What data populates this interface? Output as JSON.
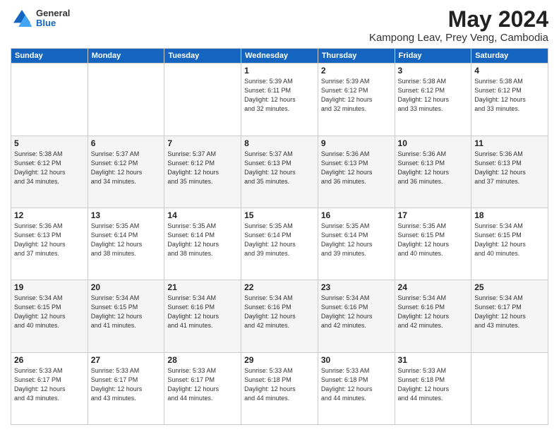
{
  "header": {
    "logo_line1": "General",
    "logo_line2": "Blue",
    "main_title": "May 2024",
    "subtitle": "Kampong Leav, Prey Veng, Cambodia"
  },
  "weekdays": [
    "Sunday",
    "Monday",
    "Tuesday",
    "Wednesday",
    "Thursday",
    "Friday",
    "Saturday"
  ],
  "weeks": [
    {
      "row_class": "normal-row",
      "days": [
        {
          "num": "",
          "info": ""
        },
        {
          "num": "",
          "info": ""
        },
        {
          "num": "",
          "info": ""
        },
        {
          "num": "1",
          "info": "Sunrise: 5:39 AM\nSunset: 6:11 PM\nDaylight: 12 hours\nand 32 minutes."
        },
        {
          "num": "2",
          "info": "Sunrise: 5:39 AM\nSunset: 6:12 PM\nDaylight: 12 hours\nand 32 minutes."
        },
        {
          "num": "3",
          "info": "Sunrise: 5:38 AM\nSunset: 6:12 PM\nDaylight: 12 hours\nand 33 minutes."
        },
        {
          "num": "4",
          "info": "Sunrise: 5:38 AM\nSunset: 6:12 PM\nDaylight: 12 hours\nand 33 minutes."
        }
      ]
    },
    {
      "row_class": "alt-row",
      "days": [
        {
          "num": "5",
          "info": "Sunrise: 5:38 AM\nSunset: 6:12 PM\nDaylight: 12 hours\nand 34 minutes."
        },
        {
          "num": "6",
          "info": "Sunrise: 5:37 AM\nSunset: 6:12 PM\nDaylight: 12 hours\nand 34 minutes."
        },
        {
          "num": "7",
          "info": "Sunrise: 5:37 AM\nSunset: 6:12 PM\nDaylight: 12 hours\nand 35 minutes."
        },
        {
          "num": "8",
          "info": "Sunrise: 5:37 AM\nSunset: 6:13 PM\nDaylight: 12 hours\nand 35 minutes."
        },
        {
          "num": "9",
          "info": "Sunrise: 5:36 AM\nSunset: 6:13 PM\nDaylight: 12 hours\nand 36 minutes."
        },
        {
          "num": "10",
          "info": "Sunrise: 5:36 AM\nSunset: 6:13 PM\nDaylight: 12 hours\nand 36 minutes."
        },
        {
          "num": "11",
          "info": "Sunrise: 5:36 AM\nSunset: 6:13 PM\nDaylight: 12 hours\nand 37 minutes."
        }
      ]
    },
    {
      "row_class": "normal-row",
      "days": [
        {
          "num": "12",
          "info": "Sunrise: 5:36 AM\nSunset: 6:13 PM\nDaylight: 12 hours\nand 37 minutes."
        },
        {
          "num": "13",
          "info": "Sunrise: 5:35 AM\nSunset: 6:14 PM\nDaylight: 12 hours\nand 38 minutes."
        },
        {
          "num": "14",
          "info": "Sunrise: 5:35 AM\nSunset: 6:14 PM\nDaylight: 12 hours\nand 38 minutes."
        },
        {
          "num": "15",
          "info": "Sunrise: 5:35 AM\nSunset: 6:14 PM\nDaylight: 12 hours\nand 39 minutes."
        },
        {
          "num": "16",
          "info": "Sunrise: 5:35 AM\nSunset: 6:14 PM\nDaylight: 12 hours\nand 39 minutes."
        },
        {
          "num": "17",
          "info": "Sunrise: 5:35 AM\nSunset: 6:15 PM\nDaylight: 12 hours\nand 40 minutes."
        },
        {
          "num": "18",
          "info": "Sunrise: 5:34 AM\nSunset: 6:15 PM\nDaylight: 12 hours\nand 40 minutes."
        }
      ]
    },
    {
      "row_class": "alt-row",
      "days": [
        {
          "num": "19",
          "info": "Sunrise: 5:34 AM\nSunset: 6:15 PM\nDaylight: 12 hours\nand 40 minutes."
        },
        {
          "num": "20",
          "info": "Sunrise: 5:34 AM\nSunset: 6:15 PM\nDaylight: 12 hours\nand 41 minutes."
        },
        {
          "num": "21",
          "info": "Sunrise: 5:34 AM\nSunset: 6:16 PM\nDaylight: 12 hours\nand 41 minutes."
        },
        {
          "num": "22",
          "info": "Sunrise: 5:34 AM\nSunset: 6:16 PM\nDaylight: 12 hours\nand 42 minutes."
        },
        {
          "num": "23",
          "info": "Sunrise: 5:34 AM\nSunset: 6:16 PM\nDaylight: 12 hours\nand 42 minutes."
        },
        {
          "num": "24",
          "info": "Sunrise: 5:34 AM\nSunset: 6:16 PM\nDaylight: 12 hours\nand 42 minutes."
        },
        {
          "num": "25",
          "info": "Sunrise: 5:34 AM\nSunset: 6:17 PM\nDaylight: 12 hours\nand 43 minutes."
        }
      ]
    },
    {
      "row_class": "normal-row",
      "days": [
        {
          "num": "26",
          "info": "Sunrise: 5:33 AM\nSunset: 6:17 PM\nDaylight: 12 hours\nand 43 minutes."
        },
        {
          "num": "27",
          "info": "Sunrise: 5:33 AM\nSunset: 6:17 PM\nDaylight: 12 hours\nand 43 minutes."
        },
        {
          "num": "28",
          "info": "Sunrise: 5:33 AM\nSunset: 6:17 PM\nDaylight: 12 hours\nand 44 minutes."
        },
        {
          "num": "29",
          "info": "Sunrise: 5:33 AM\nSunset: 6:18 PM\nDaylight: 12 hours\nand 44 minutes."
        },
        {
          "num": "30",
          "info": "Sunrise: 5:33 AM\nSunset: 6:18 PM\nDaylight: 12 hours\nand 44 minutes."
        },
        {
          "num": "31",
          "info": "Sunrise: 5:33 AM\nSunset: 6:18 PM\nDaylight: 12 hours\nand 44 minutes."
        },
        {
          "num": "",
          "info": ""
        }
      ]
    }
  ]
}
